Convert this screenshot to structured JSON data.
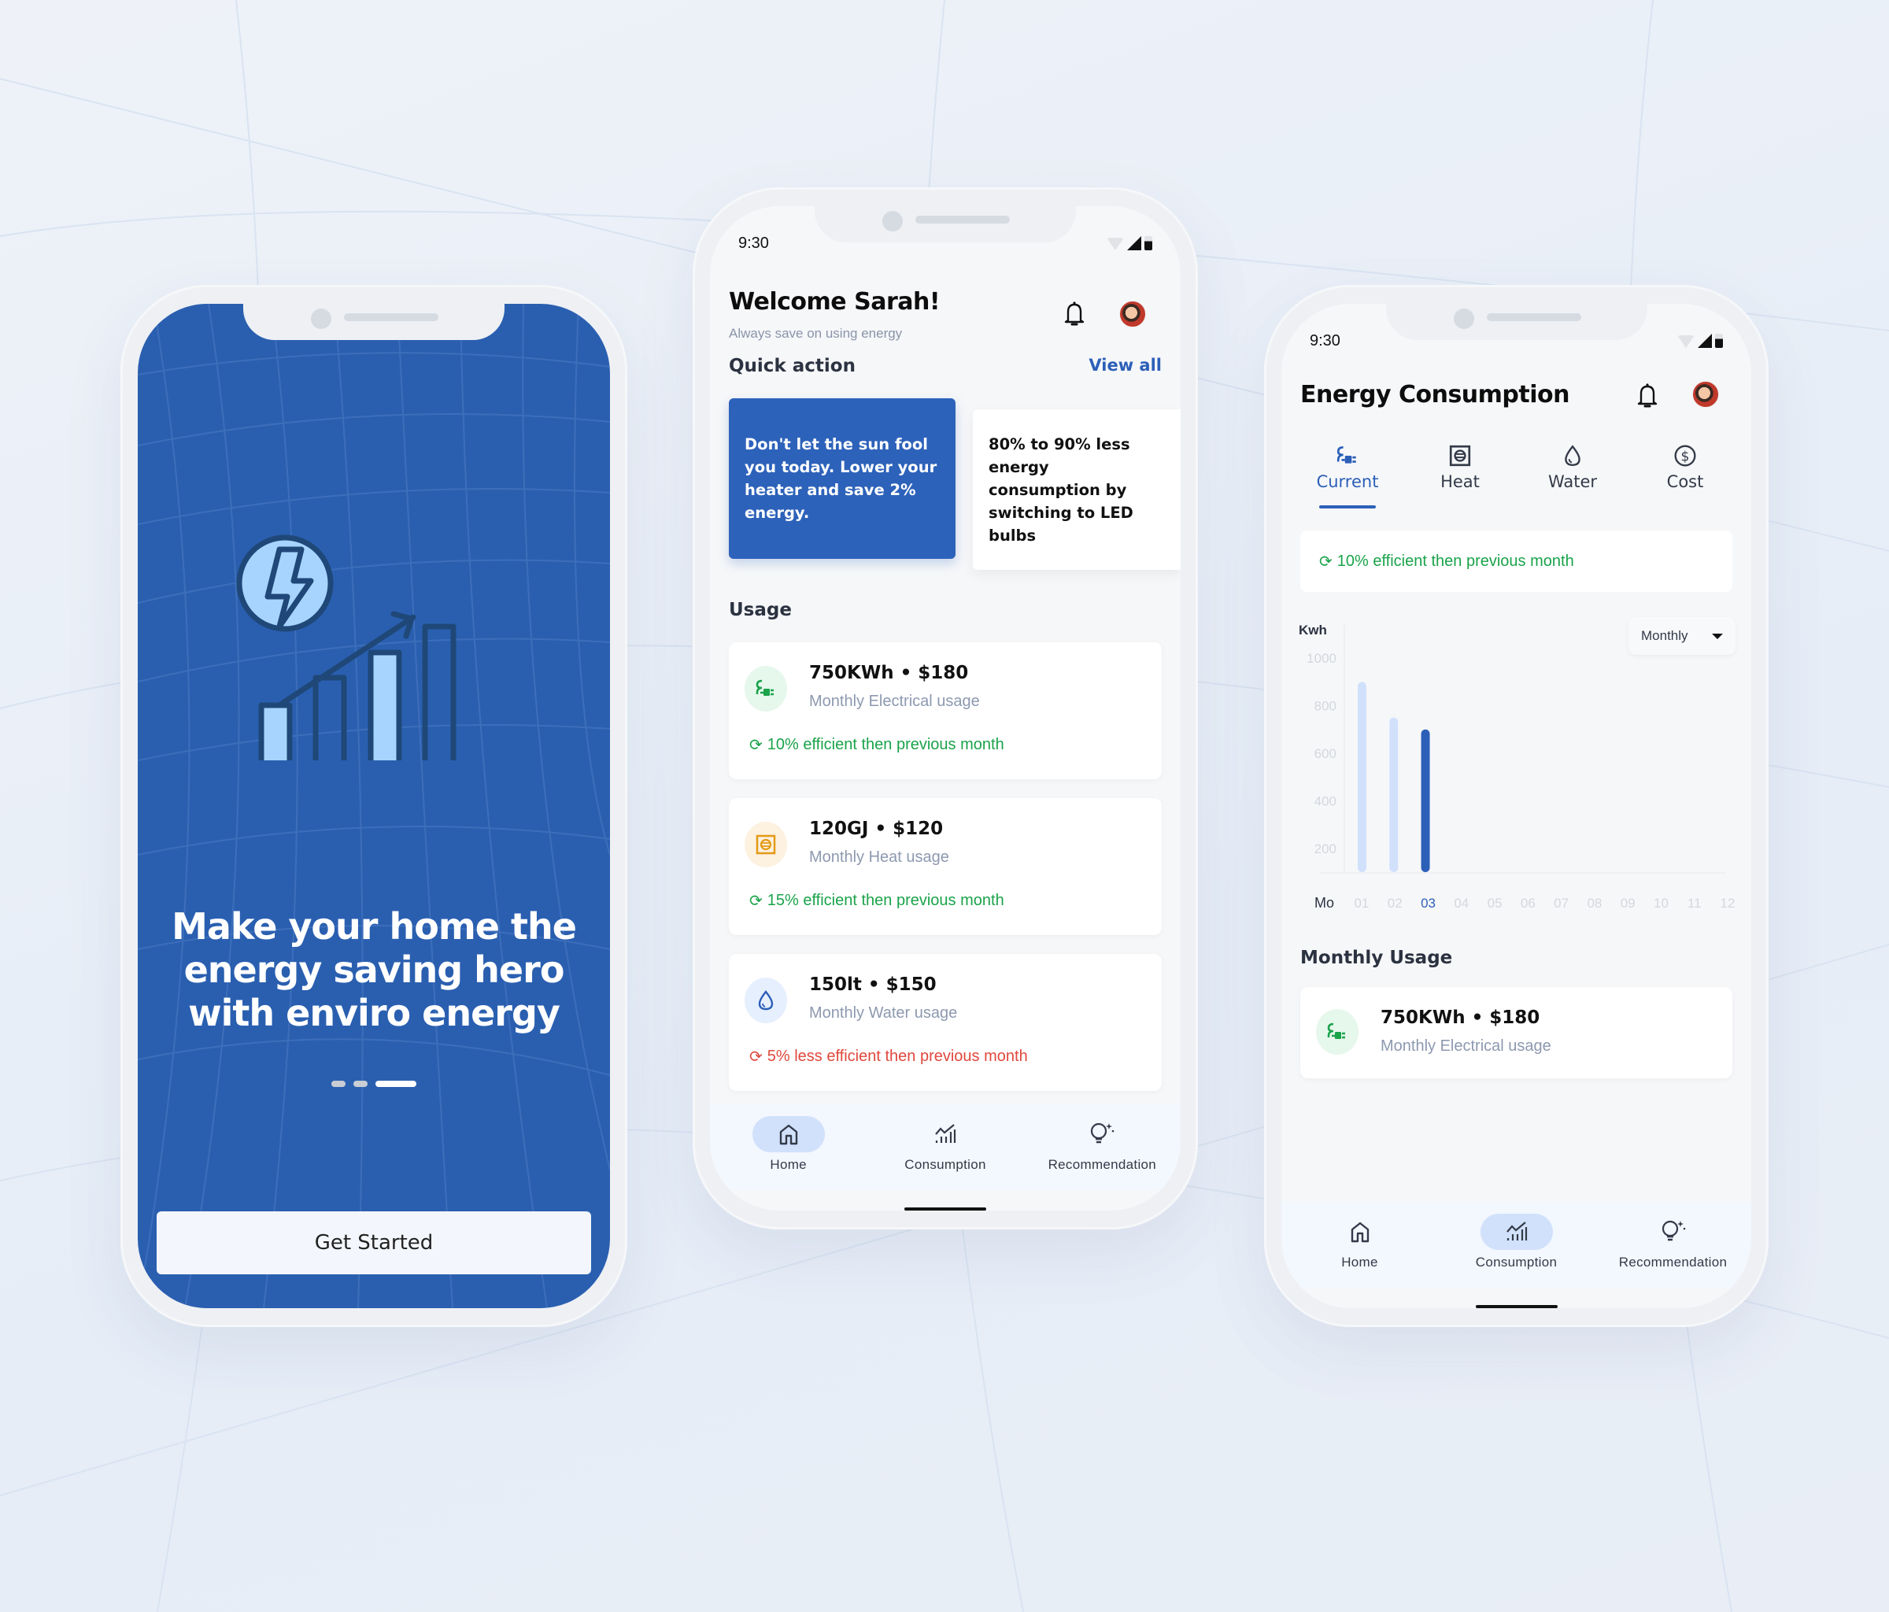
{
  "onboarding": {
    "headline": "Make your home the energy saving hero with enviro energy",
    "headline_lines": [
      "Make your home the",
      "energy saving hero",
      "with enviro energy"
    ],
    "pagination": {
      "total": 3,
      "active": 3
    },
    "cta_label": "Get Started",
    "illustration": "energy-growth-chart-illustration"
  },
  "home": {
    "status": {
      "time": "9:30"
    },
    "title": "Welcome Sarah!",
    "subtitle": "Always save on using energy",
    "quick_action": {
      "title": "Quick action",
      "view_all": "View all",
      "cards": [
        {
          "text": "Don't let the sun fool you today. Lower your heater and save 2% energy.",
          "style": "primary"
        },
        {
          "text": "80% to 90% less energy consumption by switching to LED bulbs",
          "style": "secondary"
        }
      ]
    },
    "usage": {
      "title": "Usage",
      "items": [
        {
          "icon": "plug-icon",
          "amount": "750KWh",
          "cost": "$180",
          "label": "Monthly Electrical usage",
          "trend": "10% efficient then previous month",
          "trend_status": "positive",
          "accent": "#1aa34a",
          "icon_bg": "#e6f7ec"
        },
        {
          "icon": "heater-icon",
          "amount": "120GJ",
          "cost": "$120",
          "label": "Monthly Heat usage",
          "trend": "15% efficient then previous month",
          "trend_status": "positive",
          "accent": "#e39a14",
          "icon_bg": "#fdf1e0"
        },
        {
          "icon": "water-drop-icon",
          "amount": "150lt",
          "cost": "$150",
          "label": "Monthly Water usage",
          "trend": "5% less efficient then previous month",
          "trend_status": "negative",
          "accent": "#2c5fb8",
          "icon_bg": "#e6effd"
        }
      ]
    },
    "nav": [
      {
        "label": "Home",
        "icon": "home-icon",
        "active": true
      },
      {
        "label": "Consumption",
        "icon": "chart-icon",
        "active": false
      },
      {
        "label": "Recommendation",
        "icon": "lightbulb-icon",
        "active": false
      }
    ]
  },
  "consumption": {
    "status": {
      "time": "9:30"
    },
    "title": "Energy Consumption",
    "tabs": [
      {
        "label": "Current",
        "icon": "plug-icon",
        "active": true
      },
      {
        "label": "Heat",
        "icon": "heater-icon",
        "active": false
      },
      {
        "label": "Water",
        "icon": "water-drop-icon",
        "active": false
      },
      {
        "label": "Cost",
        "icon": "dollar-icon",
        "active": false
      }
    ],
    "efficiency": "10% efficient then previous month",
    "period_select": {
      "value": "Monthly"
    },
    "monthly_usage": {
      "title": "Monthly Usage",
      "amount": "750KWh",
      "cost": "$180",
      "label": "Monthly Electrical usage"
    },
    "nav": [
      {
        "label": "Home",
        "icon": "home-icon",
        "active": false
      },
      {
        "label": "Consumption",
        "icon": "chart-icon",
        "active": true
      },
      {
        "label": "Recommendation",
        "icon": "lightbulb-icon",
        "active": false
      }
    ]
  },
  "colors": {
    "primary": "#2c5fb8",
    "onboarding_bg": "#2a5fb0",
    "bar_light": "#d1e1fb",
    "positive": "#1aa34a",
    "negative": "#e0483c"
  },
  "chart_data": {
    "type": "bar",
    "title": "",
    "ylabel": "Kwh",
    "xlabel": "Mo",
    "categories": [
      "01",
      "02",
      "03",
      "04",
      "05",
      "06",
      "07",
      "08",
      "09",
      "10",
      "11",
      "12"
    ],
    "values": [
      900,
      750,
      700,
      null,
      null,
      null,
      null,
      null,
      null,
      null,
      null,
      null
    ],
    "highlighted": "03",
    "yticks": [
      200,
      400,
      600,
      800,
      1000
    ],
    "ylim": [
      100,
      1100
    ],
    "grid": false
  }
}
